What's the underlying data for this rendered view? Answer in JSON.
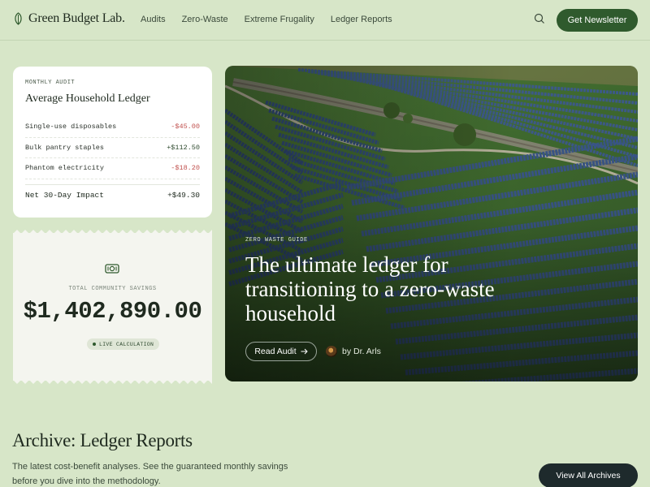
{
  "header": {
    "brand": "Green Budget Lab.",
    "nav": [
      "Audits",
      "Zero-Waste",
      "Extreme Frugality",
      "Ledger Reports"
    ],
    "cta_label": "Get Newsletter",
    "search_icon": "search-icon"
  },
  "ledger_card": {
    "eyebrow": "MONTHLY AUDIT",
    "title": "Average Household Ledger",
    "rows": [
      {
        "label": "Single-use disposables",
        "value": "-$45.00"
      },
      {
        "label": "Bulk pantry staples",
        "value": "+$112.50"
      },
      {
        "label": "Phantom electricity",
        "value": "-$18.20"
      }
    ],
    "total_label": "Net 30-Day Impact",
    "total_value": "+$49.30"
  },
  "savings_card": {
    "label": "TOTAL COMMUNITY SAVINGS",
    "value": "$1,402,890.00",
    "badge": "LIVE CALCULATION",
    "icon": "cash-icon"
  },
  "hero": {
    "eyebrow": "ZERO WASTE GUIDE",
    "title": "The ultimate ledger for transitioning to a zero-waste household",
    "button_label": "Read Audit",
    "author": "by Dr. Arls"
  },
  "archive": {
    "title": "Archive: Ledger Reports",
    "description": "The latest cost-benefit analyses. See the guaranteed monthly savings before you dive into the methodology.",
    "button_label": "View All Archives"
  },
  "colors": {
    "background": "#d7e6c8",
    "brand_green": "#2f5a2d",
    "negative": "#c0504d",
    "dark_button": "#1e2a2c"
  }
}
